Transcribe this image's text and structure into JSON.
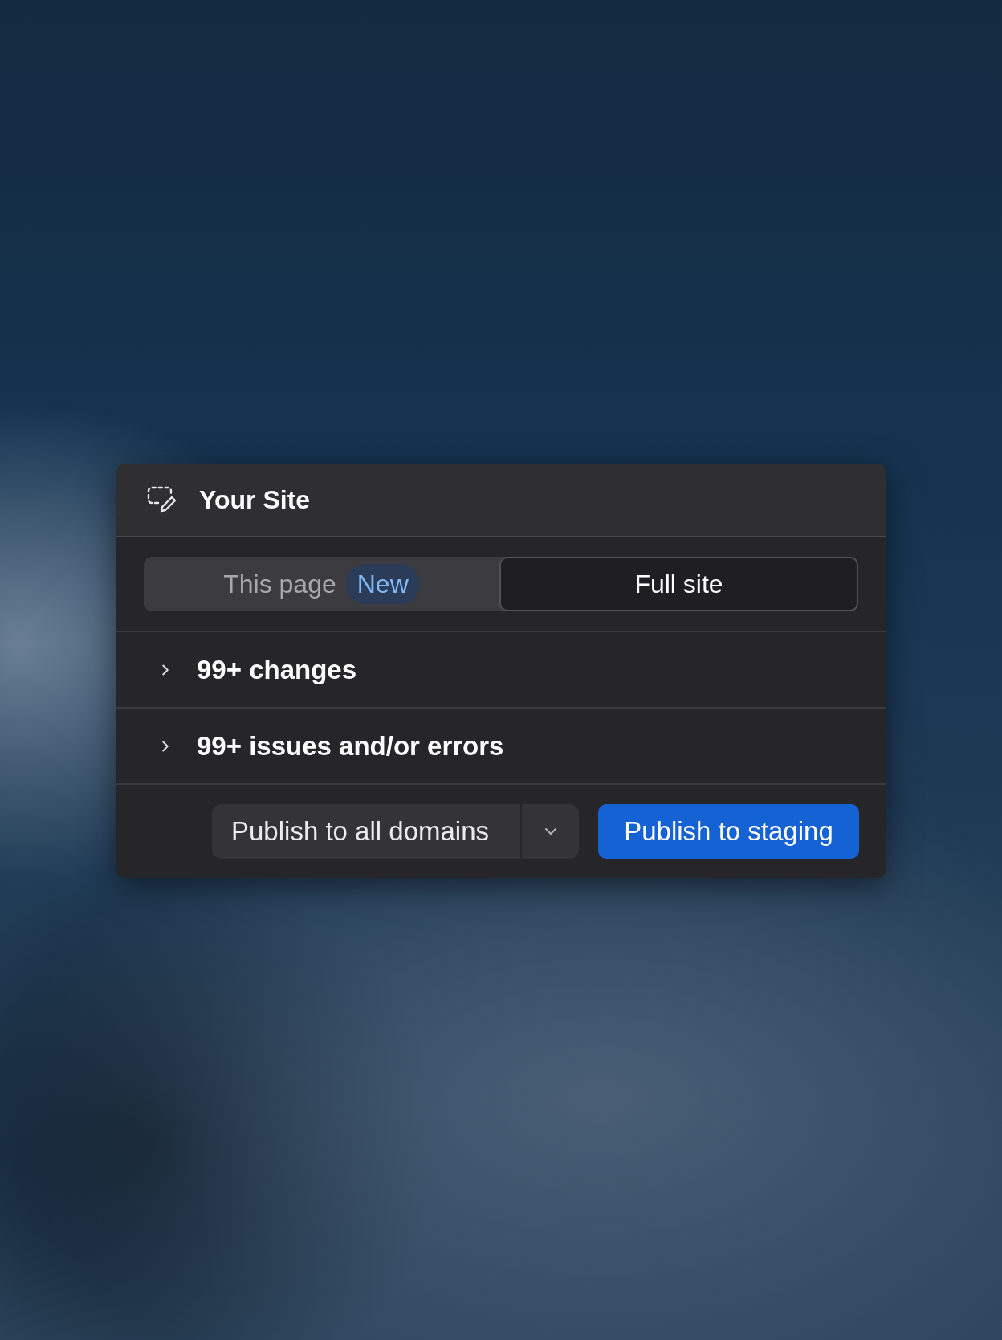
{
  "panel": {
    "title": "Your Site"
  },
  "scope_tabs": [
    {
      "label": "This page",
      "badge": "New",
      "selected": false
    },
    {
      "label": "Full site",
      "selected": true
    }
  ],
  "sections": [
    {
      "label": "99+ changes",
      "expanded": false
    },
    {
      "label": "99+ issues and/or errors",
      "expanded": false
    }
  ],
  "actions": {
    "split_button": {
      "label": "Publish to all domains"
    },
    "primary_button": {
      "label": "Publish to staging"
    }
  }
}
